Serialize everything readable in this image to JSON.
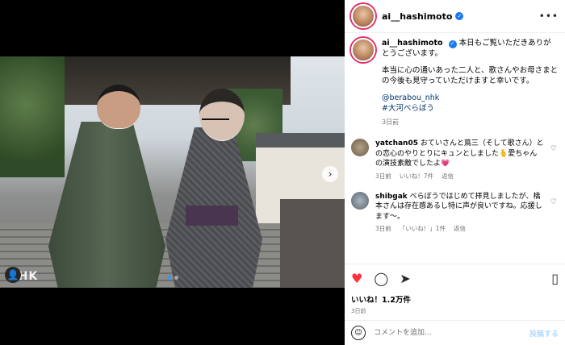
{
  "header": {
    "username": "ai__hashimoto",
    "more_label": "•••"
  },
  "caption": {
    "username": "ai__hashimoto",
    "line1": "本日もご覧いただきありがとうございます。",
    "line2": "本当に心の通いあった二人と、歌さんやお母さまとの今後も見守っていただけますと幸いです。",
    "mention": "@berabou_nhk",
    "hashtag": "#大河べらぼう",
    "time": "3日前"
  },
  "comments": [
    {
      "user": "yatchan05",
      "text": "おていさんと蔦三（そして歌さん）との恋心のやりとりにキュンとしました🫰愛ちゃんの演技素敵でしたよ💗",
      "time": "3日前",
      "likes": "いいね！7件",
      "reply": "返信"
    },
    {
      "user": "shibgak",
      "text": "べらぼうではじめて拝見しましたが、橋本さんは存在感あるし特に声が良いですね。応援します～。",
      "time": "3日前",
      "likes": "「いいね！」1件",
      "reply": "返信"
    }
  ],
  "likes": {
    "text": "いいね！1.2万件"
  },
  "post_date": "3日前",
  "comment_input": {
    "placeholder": "コメントを追加...",
    "post_label": "投稿する"
  },
  "photo": {
    "watermark": "NHK"
  },
  "icons": {
    "like": "heart-icon",
    "comment": "comment-icon",
    "share": "share-icon",
    "save": "bookmark-icon",
    "emoji": "emoji-icon"
  }
}
